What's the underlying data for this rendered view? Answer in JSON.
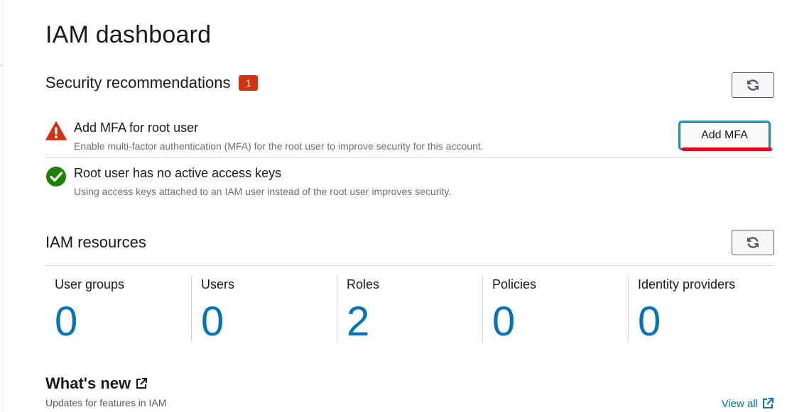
{
  "page": {
    "title": "IAM dashboard"
  },
  "security": {
    "title": "Security recommendations",
    "badge_count": "1",
    "refresh_icon": "refresh-icon",
    "items": [
      {
        "status": "warning",
        "icon": "warning-triangle-icon",
        "title": "Add MFA for root user",
        "description": "Enable multi-factor authentication (MFA) for the root user to improve security for this account.",
        "action_label": "Add MFA"
      },
      {
        "status": "success",
        "icon": "check-circle-icon",
        "title": "Root user has no active access keys",
        "description": "Using access keys attached to an IAM user instead of the root user improves security."
      }
    ]
  },
  "resources": {
    "title": "IAM resources",
    "refresh_icon": "refresh-icon",
    "items": [
      {
        "label": "User groups",
        "value": "0"
      },
      {
        "label": "Users",
        "value": "0"
      },
      {
        "label": "Roles",
        "value": "2"
      },
      {
        "label": "Policies",
        "value": "0"
      },
      {
        "label": "Identity providers",
        "value": "0"
      }
    ]
  },
  "whats_new": {
    "title": "What's new",
    "subtitle": "Updates for features in IAM",
    "view_all_label": "View all",
    "external_icon": "external-link-icon"
  },
  "colors": {
    "link": "#0073bb",
    "badge": "#d13212",
    "warning": "#d13212",
    "success": "#1d8102",
    "annotation_underline": "#e3001b"
  }
}
